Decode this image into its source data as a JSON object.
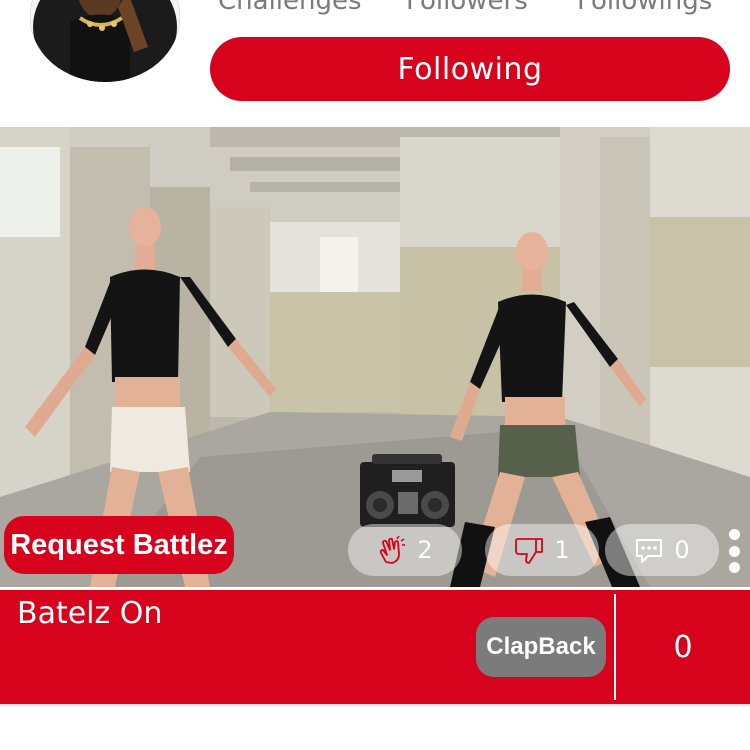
{
  "profile": {
    "stats": {
      "challenges_label": "Challenges",
      "followers_label": "Followers",
      "followings_label": "Followings"
    },
    "follow_button_label": "Following"
  },
  "post": {
    "request_button_label": "Request Battlez",
    "reactions": {
      "claps": "2",
      "dislikes": "1",
      "comments": "0"
    },
    "title": "Batelz On",
    "clapback_label": "ClapBack",
    "score": "0"
  },
  "colors": {
    "brand_red": "#d7021c",
    "gray_button": "#7b7b7b",
    "stat_text": "#7b7b7b"
  },
  "icons": [
    "clap-icon",
    "thumbs-down-icon",
    "comment-icon",
    "more-vertical-icon"
  ]
}
